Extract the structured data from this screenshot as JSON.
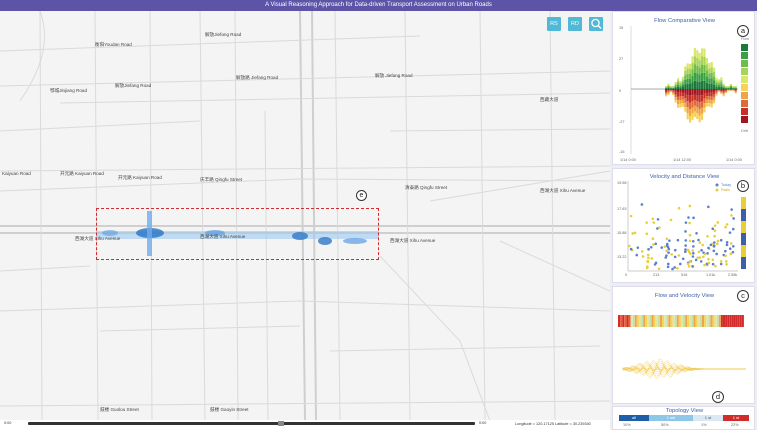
{
  "window": {
    "title": "A Visual Reasoning Approach for Data-driven Transport Assessment on Urban Roads"
  },
  "toolbar": {
    "rs_label": "RS",
    "rd_label": "RD",
    "search_icon": "search-icon"
  },
  "map": {
    "roads": [
      "西藏大道",
      "衡阳Youdan Road",
      "解放Jiefang Road",
      "解放Jiefang Road",
      "解放路 Jiefang Road",
      "解放 Jiefang Road",
      "鄂城Jinjiang Road",
      "开元路 Kaiyuan Road",
      "开元路 Kaiyuan Road",
      "Kaiyuan Road",
      "庆丰路 Qingfu Street",
      "清泰路 Qingfu Street",
      "西湖大道 Xihu Avenue",
      "西湖大道 Xihu Avenue",
      "西湖大道 Xihu Avenue",
      "西湖大道 Xihu Avenue",
      "鼓楼 Guolou Street",
      "鼓楼 Gaoyin Street"
    ],
    "marker": "e"
  },
  "footer": {
    "time_start": "0:00",
    "time_end": "0:00",
    "coords": "Longitude = 120.17125 Latitude = 30.239340"
  },
  "panels": {
    "a": {
      "title": "Flow Comparative View",
      "badge": "a",
      "y_ticks": [
        "15",
        "27",
        "0",
        "-27",
        "-15"
      ],
      "x_ticks": [
        "1/14 0:00",
        "1/14 12:00",
        "1/14 0:00"
      ],
      "legend_top": "Flow",
      "legend_bottom": "Drift"
    },
    "b": {
      "title": "Velocity and Distance View",
      "badge": "b",
      "legend": [
        "Today",
        "Ratio"
      ],
      "y_ticks": [
        "19.58",
        "17.63",
        "15.88",
        "13.22",
        "0"
      ],
      "x_ticks": [
        "0",
        "213",
        "516",
        "1.01k",
        "2.55k"
      ]
    },
    "c": {
      "title": "Flow and Velocity View",
      "badge": "c"
    },
    "d": {
      "title": "Topology View",
      "badge": "d",
      "segments": [
        "all",
        "1 sel",
        "1 st",
        "1 st"
      ],
      "ticks": [
        "10%",
        "50%",
        "1%",
        "22%"
      ]
    }
  },
  "colors": {
    "accent": "#3b5fa8",
    "title_bg": "#5d54a8",
    "select": "#d12b2b",
    "blue_point": "#5b7fd1",
    "yellow_point": "#e8cf3a"
  }
}
